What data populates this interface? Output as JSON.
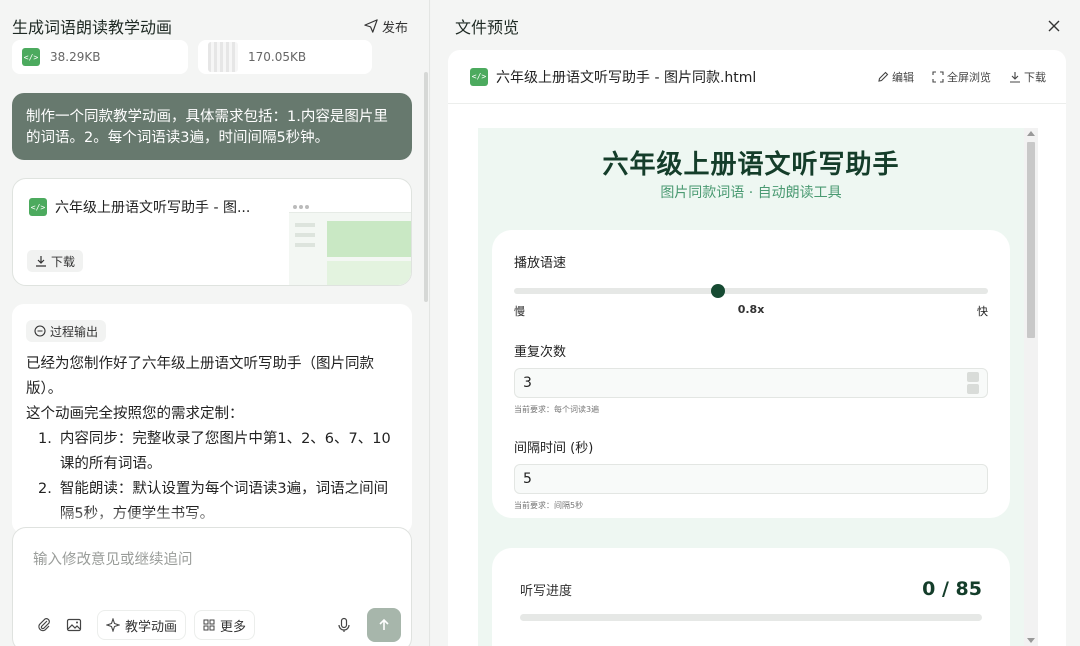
{
  "left": {
    "title": "生成词语朗读教学动画",
    "publish_label": "发布",
    "attachments": [
      {
        "size": "38.29KB",
        "icon": "code-file-icon"
      },
      {
        "size": "170.05KB",
        "icon": "image-file-icon"
      }
    ],
    "user_message": "制作一个同款教学动画，具体需求包括：1.内容是图片里的词语。2。每个词语读3遍，时间间隔5秒钟。",
    "file_card": {
      "title": "六年级上册语文听写助手 - 图...",
      "download_label": "下载"
    },
    "process_label": "过程输出",
    "answer": {
      "intro": "已经为您制作好了六年级上册语文听写助手（图片同款版）。",
      "lead": "这个动画完全按照您的需求定制：",
      "items": [
        {
          "n": "1.",
          "text": "内容同步：完整收录了您图片中第1、2、6、7、10课的所有词语。"
        },
        {
          "n": "2.",
          "text": "智能朗读：默认设置为每个词语读3遍，词语之间间隔5秒，方便学生书写。"
        }
      ]
    },
    "input": {
      "placeholder": "输入修改意见或继续追问",
      "teach_anim_label": "教学动画",
      "more_label": "更多"
    }
  },
  "right": {
    "title": "文件预览",
    "file_name": "六年级上册语文听写助手 - 图片同款.html",
    "actions": {
      "edit": "编辑",
      "fullscreen": "全屏浏览",
      "download": "下载"
    },
    "preview": {
      "heading": "六年级上册语文听写助手",
      "subheading": "图片同款词语 · 自动朗读工具",
      "speed": {
        "label": "播放语速",
        "min_label": "慢",
        "max_label": "快",
        "value": "0.8x",
        "position": 0.43
      },
      "repeat": {
        "label": "重复次数",
        "value": "3",
        "hint": "当前要求：每个词读3遍"
      },
      "interval": {
        "label": "间隔时间 (秒)",
        "value": "5",
        "hint": "当前要求：间隔5秒"
      },
      "progress": {
        "label": "听写进度",
        "value": "0 / 85",
        "fraction": 0
      }
    }
  },
  "colors": {
    "user_bubble": "#67796e",
    "brand_dark": "#143d2a",
    "accent_green": "#4a9a72",
    "file_icon": "#4caa5e"
  }
}
